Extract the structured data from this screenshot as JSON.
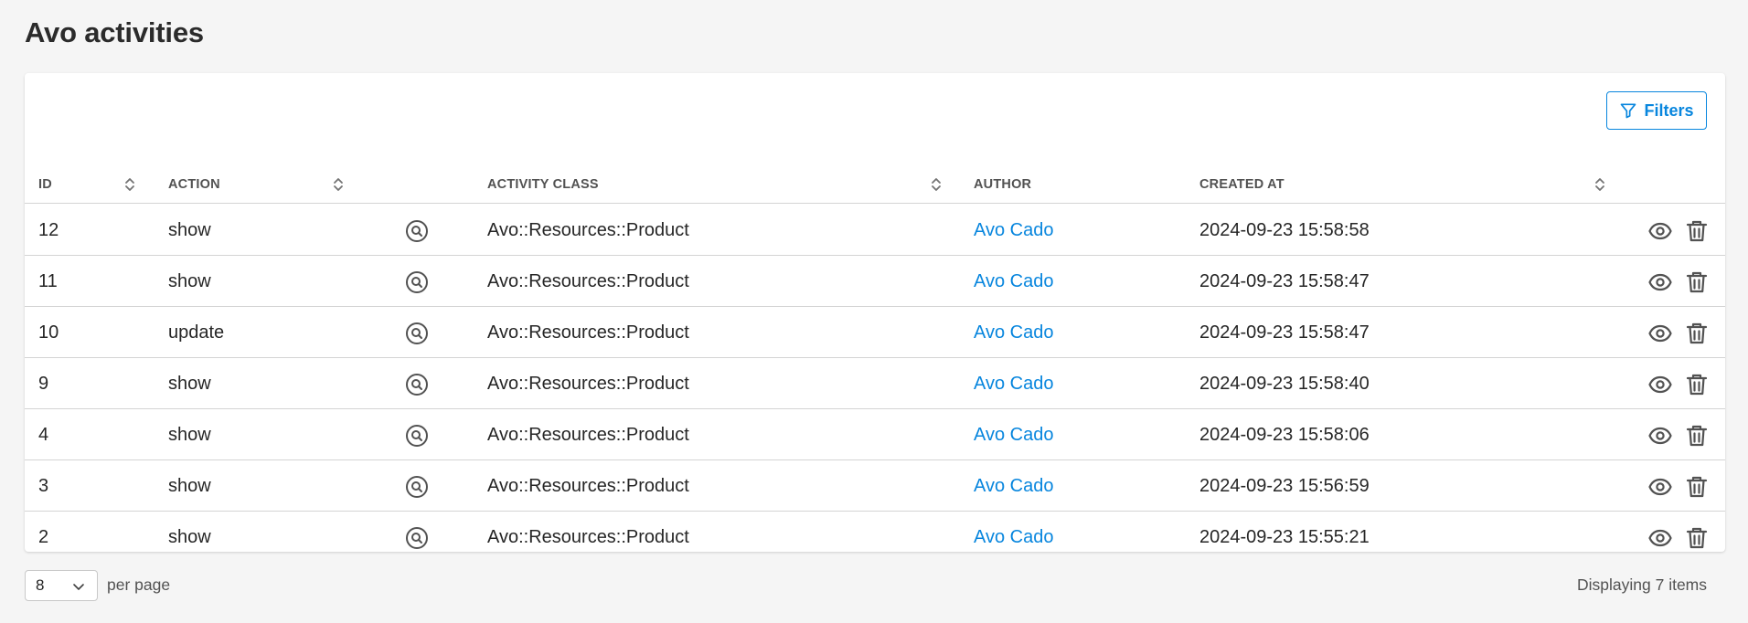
{
  "page": {
    "title": "Avo activities"
  },
  "toolbar": {
    "filters_label": "Filters"
  },
  "table": {
    "columns": {
      "id": "ID",
      "action": "ACTION",
      "activity_class": "ACTIVITY CLASS",
      "author": "AUTHOR",
      "created_at": "CREATED AT"
    },
    "rows": [
      {
        "id": "12",
        "action": "show",
        "activity_class": "Avo::Resources::Product",
        "author": "Avo Cado",
        "created_at": "2024-09-23 15:58:58"
      },
      {
        "id": "11",
        "action": "show",
        "activity_class": "Avo::Resources::Product",
        "author": "Avo Cado",
        "created_at": "2024-09-23 15:58:47"
      },
      {
        "id": "10",
        "action": "update",
        "activity_class": "Avo::Resources::Product",
        "author": "Avo Cado",
        "created_at": "2024-09-23 15:58:47"
      },
      {
        "id": "9",
        "action": "show",
        "activity_class": "Avo::Resources::Product",
        "author": "Avo Cado",
        "created_at": "2024-09-23 15:58:40"
      },
      {
        "id": "4",
        "action": "show",
        "activity_class": "Avo::Resources::Product",
        "author": "Avo Cado",
        "created_at": "2024-09-23 15:58:06"
      },
      {
        "id": "3",
        "action": "show",
        "activity_class": "Avo::Resources::Product",
        "author": "Avo Cado",
        "created_at": "2024-09-23 15:56:59"
      },
      {
        "id": "2",
        "action": "show",
        "activity_class": "Avo::Resources::Product",
        "author": "Avo Cado",
        "created_at": "2024-09-23 15:55:21"
      }
    ],
    "row_icons": [
      "search-circle-icon",
      "eye-icon",
      "trash-icon"
    ]
  },
  "pagination": {
    "per_page_value": "8",
    "per_page_label": "per page",
    "displaying_text": "Displaying 7 items"
  },
  "colors": {
    "accent": "#0886de",
    "background": "#f5f5f5",
    "panel": "#ffffff",
    "border": "#d4d4d4"
  }
}
